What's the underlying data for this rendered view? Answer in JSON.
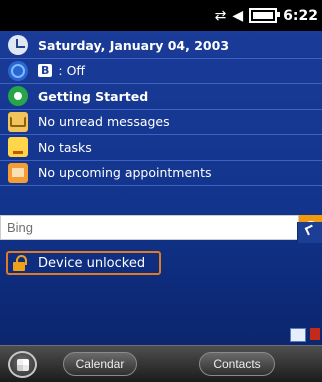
{
  "status_bar": {
    "time": "6:22",
    "icons": [
      "data-connection-icon",
      "volume-icon",
      "battery-icon"
    ]
  },
  "today_items": [
    {
      "icon": "clock-icon",
      "text": "Saturday, January 04, 2003",
      "bold": true
    },
    {
      "icon": "wireless-icon",
      "prefix": "B",
      "text": ": Off",
      "bold": false
    },
    {
      "icon": "getting-started-icon",
      "text": "Getting Started",
      "bold": true
    },
    {
      "icon": "messages-icon",
      "text": "No unread messages",
      "bold": false
    },
    {
      "icon": "tasks-icon",
      "text": "No tasks",
      "bold": false
    },
    {
      "icon": "calendar-icon",
      "text": "No upcoming appointments",
      "bold": false
    }
  ],
  "search": {
    "placeholder": "Bing",
    "value": "Bing"
  },
  "device_status": {
    "text": "Device unlocked"
  },
  "bottom_bar": {
    "left_soft_key": "Calendar",
    "right_soft_key": "Contacts"
  },
  "colors": {
    "background": "#1b3d9a",
    "accent_orange": "#f09a0c",
    "focus_border": "#e07b25",
    "bar_dark": "#1b1b1b"
  }
}
